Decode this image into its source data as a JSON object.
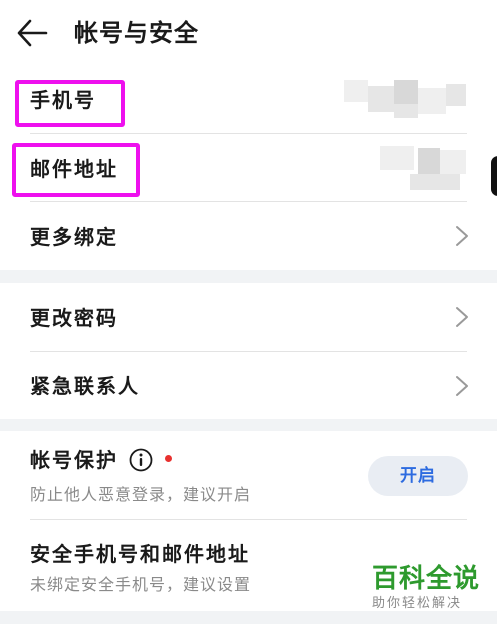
{
  "header": {
    "title": "帐号与安全",
    "back_icon": "back-arrow-icon"
  },
  "account_section": {
    "phone_label": "手机号",
    "email_label": "邮件地址",
    "more_binding_label": "更多绑定"
  },
  "security_section": {
    "change_password_label": "更改密码",
    "emergency_contact_label": "紧急联系人"
  },
  "protection_section": {
    "account_protection_label": "帐号保护",
    "account_protection_desc": "防止他人恶意登录，建议开启",
    "enable_button_label": "开启",
    "secure_phone_email_label": "安全手机号和邮件地址",
    "secure_phone_email_desc": "未绑定安全手机号，建议设置"
  },
  "watermark": {
    "title": "百科全说",
    "subtitle": "助你轻松解决"
  },
  "colors": {
    "highlight": "#ee10ee",
    "accent_blue": "#2d6be0",
    "red_dot": "#e8312f",
    "watermark_green": "#2e9a2e"
  }
}
